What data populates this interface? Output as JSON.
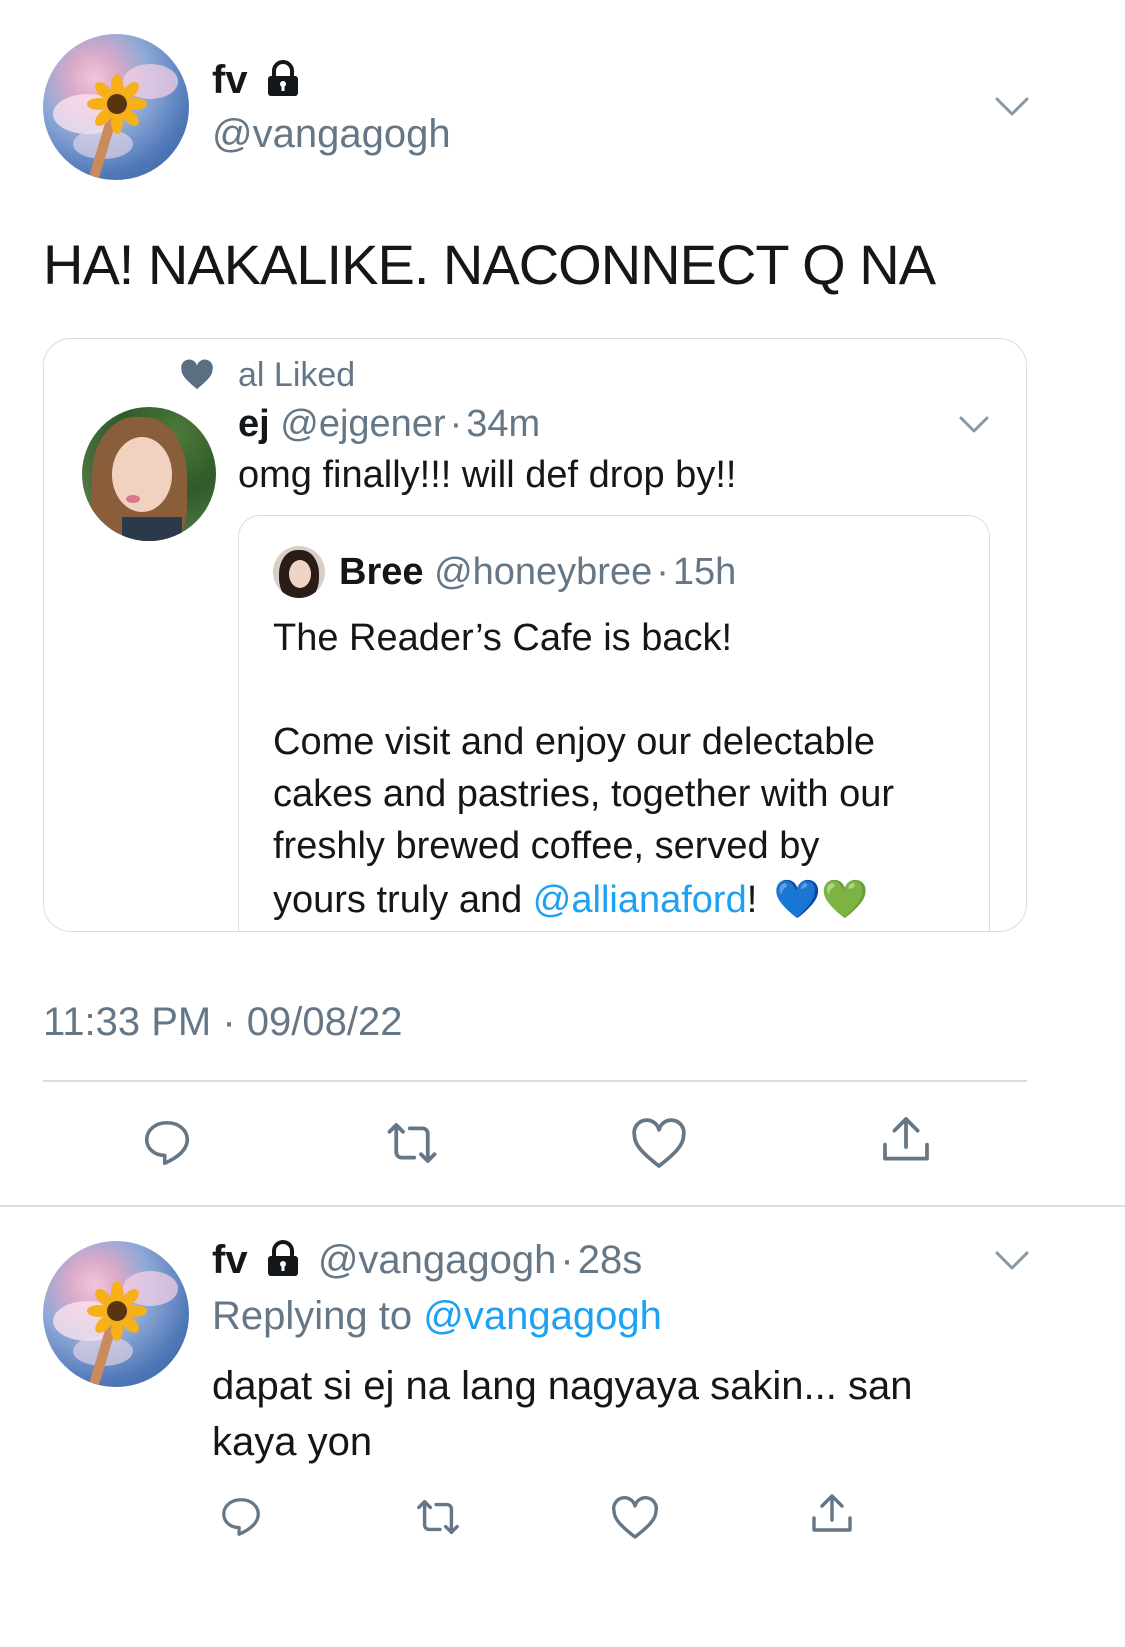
{
  "main_tweet": {
    "name": "fv",
    "handle": "@vangagogh",
    "text": "HA! NAKALIKE. NACONNECT Q NA",
    "timestamp": "11:33 PM · 09/08/22"
  },
  "embedded_tweet": {
    "social_context": "al Liked",
    "name": "ej",
    "handle": "@ejgener",
    "sep": "·",
    "age": "34m",
    "text": "omg finally!!! will def drop by!!"
  },
  "quoted_tweet": {
    "name": "Bree",
    "handle": "@honeybree",
    "sep": "·",
    "age": "15h",
    "line1": "The Reader’s Cafe is back!",
    "line2": "Come visit and enjoy our delectable",
    "line3": "cakes and pastries, together with our",
    "line4": "freshly brewed coffee, served by",
    "line5_prefix": "yours truly and ",
    "mention": "@allianaford",
    "line5_suffix": "!",
    "emoji": "💙💚"
  },
  "reply": {
    "name": "fv",
    "handle": "@vangagogh",
    "sep": "·",
    "age": "28s",
    "replying_label": "Replying to ",
    "replying_handle": "@vangagogh",
    "line1": "dapat si ej na lang nagyaya sakin... san",
    "line2": "kaya yon"
  },
  "icons": {
    "reply": "comment-icon",
    "retweet": "retweet-icon",
    "like": "heart-icon",
    "share": "share-icon",
    "lock": "lock-icon",
    "chevron": "chevron-down-icon"
  },
  "colors": {
    "text": "#14171a",
    "muted": "#657786",
    "link": "#1da1f2",
    "border": "#d7dde2"
  }
}
